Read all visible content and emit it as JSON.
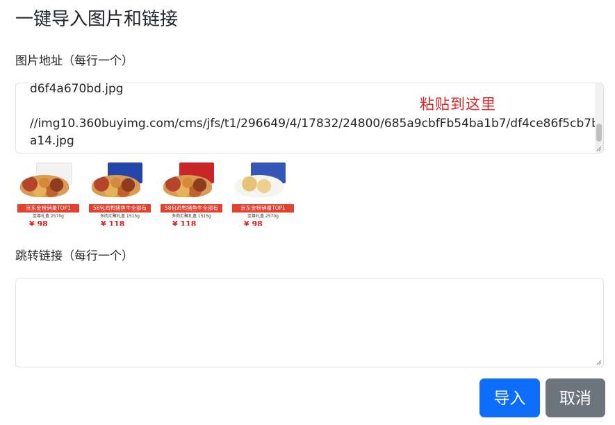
{
  "page": {
    "title": "一键导入图片和链接"
  },
  "image_urls": {
    "label": "图片地址（每行一个）",
    "lines": "d6f4a670bd.jpg\n\n//img10.360buyimg.com/cms/jfs/t1/296649/4/17832/24800/685a9cbfFb54ba1b7/df4ce86f5cb7ba14.jpg",
    "hint": "粘贴到这里",
    "hint_color": "#dc2626"
  },
  "thumbnails": [
    {
      "banner": "京东金榜销量TOP1",
      "sub": "至尊礼盒 2570g",
      "price": "¥ 98"
    },
    {
      "banner": "58包鸡鸭猪鱼牛全部有",
      "sub": "多肉汇聚礼盒 1515g",
      "price": "¥ 118"
    },
    {
      "banner": "58包鸡鸭猪鱼牛全部有",
      "sub": "多肉汇聚礼盒 1515g",
      "price": "¥ 118"
    },
    {
      "banner": "京东金榜销量TOP1",
      "sub": "至尊礼盒 2570g",
      "price": "¥ 98"
    }
  ],
  "jump_links": {
    "label": "跳转链接（每行一个）",
    "value": ""
  },
  "buttons": {
    "import": "导入",
    "cancel": "取消"
  },
  "colors": {
    "primary": "#0d6efd",
    "secondary": "#6c757d",
    "banner": "#e2412d"
  }
}
